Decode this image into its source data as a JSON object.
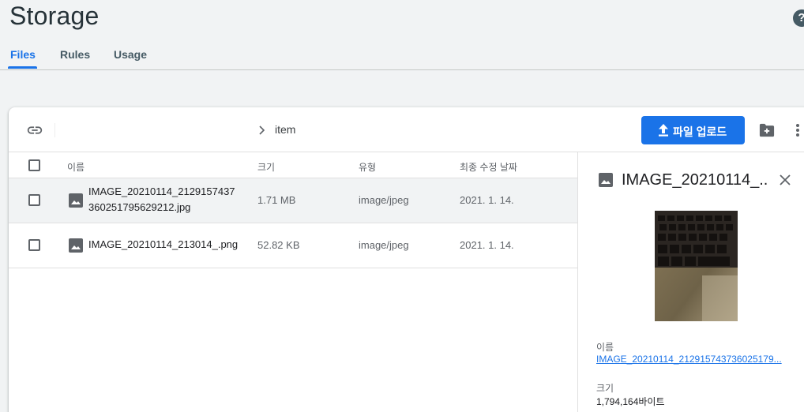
{
  "header": {
    "title": "Storage",
    "help_icon": "help-circle-icon",
    "tabs": [
      {
        "label": "Files",
        "active": true
      },
      {
        "label": "Rules",
        "active": false
      },
      {
        "label": "Usage",
        "active": false
      }
    ]
  },
  "toolbar": {
    "link_icon": "link-icon",
    "chevron_icon": "chevron-right-icon",
    "path": "item",
    "upload_label": "파일 업로드",
    "upload_icon": "upload-icon",
    "new_folder_icon": "create-folder-icon",
    "more_icon": "more-vert-icon"
  },
  "table": {
    "columns": {
      "name": "이름",
      "size": "크기",
      "type": "유형",
      "modified": "최종 수정 날짜"
    },
    "rows": [
      {
        "name_line1": "IMAGE_20210114_2129157437",
        "name_line2": "360251795629212.jpg",
        "size": "1.71 MB",
        "type": "image/jpeg",
        "modified": "2021. 1. 14.",
        "icon": "image-icon"
      },
      {
        "name_line1": "IMAGE_20210114_213014_.png",
        "size": "52.82 KB",
        "type": "image/jpeg",
        "modified": "2021. 1. 14.",
        "icon": "image-icon"
      }
    ]
  },
  "detail": {
    "title": "IMAGE_20210114_...",
    "close_icon": "close-icon",
    "name_label": "이름",
    "name_value": "IMAGE_20210114_212915743736025179...",
    "size_label": "크기",
    "size_value": "1,794,164바이트"
  },
  "colors": {
    "accent": "#1a73e8",
    "background": "#f1f3f4",
    "title": "#263238"
  }
}
